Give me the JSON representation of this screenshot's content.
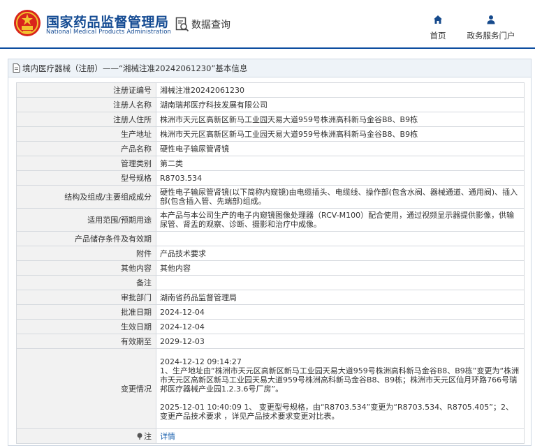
{
  "header": {
    "brand_cn": "国家药品监督管理局",
    "brand_en": "National Medical Products Administration",
    "query_label": "数据查询",
    "nav": [
      {
        "label": "首页",
        "icon": "home-icon"
      },
      {
        "label": "政务服务门户",
        "icon": "user-icon"
      }
    ]
  },
  "panel": {
    "title": "境内医疗器械（注册）——“湘械注准20242061230”基本信息",
    "rows": [
      {
        "label": "注册证编号",
        "value": "湘械注准20242061230"
      },
      {
        "label": "注册人名称",
        "value": "湖南瑞邦医疗科技发展有限公司"
      },
      {
        "label": "注册人住所",
        "value": "株洲市天元区高新区新马工业园天易大道959号株洲高科新马金谷B8、B9栋"
      },
      {
        "label": "生产地址",
        "value": "株洲市天元区高新区新马工业园天易大道959号株洲高科新马金谷B8、B9栋"
      },
      {
        "label": "产品名称",
        "value": "硬性电子输尿管肾镜"
      },
      {
        "label": "管理类别",
        "value": "第二类"
      },
      {
        "label": "型号规格",
        "value": "R8703.534"
      },
      {
        "label": "结构及组成/主要组成成分",
        "value": "硬性电子输尿管肾镜(以下简称内窥镜)由电缆插头、电缆线、操作部(包含水阀、器械通道、通用阀)、插入部(包含插入管、先端部)组成。"
      },
      {
        "label": "适用范围/预期用途",
        "value": "本产品与本公司生产的电子内窥镜图像处理器（RCV-M100）配合使用，通过视频显示器提供影像，供输尿管、肾盂的观察、诊断、摄影和治疗中成像。"
      },
      {
        "label": "产品储存条件及有效期",
        "value": ""
      },
      {
        "label": "附件",
        "value": "产品技术要求"
      },
      {
        "label": "其他内容",
        "value": "其他内容"
      },
      {
        "label": "备注",
        "value": ""
      },
      {
        "label": "审批部门",
        "value": "湖南省药品监督管理局"
      },
      {
        "label": "批准日期",
        "value": "2024-12-04"
      },
      {
        "label": "生效日期",
        "value": "2024-12-04"
      },
      {
        "label": "有效期至",
        "value": "2029-12-03"
      },
      {
        "label": "变更情况",
        "value": "2024-12-12 09:14:27\n1、生产地址由“株洲市天元区高新区新马工业园天易大道959号株洲高科新马金谷B8、B9栋”变更为“株洲市天元区高新区新马工业园天易大道959号株洲高科新马金谷B8、B9栋；株洲市天元区仙月环路766号瑞邦医疗器械产业园1.2.3.6号厂房”。\n\n2025-12-01 10:40:09 1、 变更型号规格，由“R8703.534”变更为“R8703.534、R8705.405”；2、 变更产品技术要求 ，详见产品技术要求变更对比表。"
      },
      {
        "label": "注",
        "value": "详情"
      }
    ]
  }
}
